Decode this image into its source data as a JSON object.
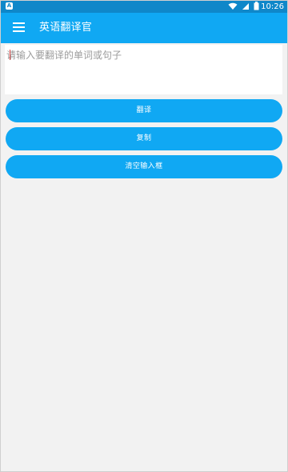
{
  "status_bar": {
    "left_badge": "A",
    "time": "10:26",
    "icons": [
      "wifi-icon",
      "cell-signal-icon",
      "battery-icon"
    ],
    "color": "#0f87c9"
  },
  "app_bar": {
    "title": "英语翻译官",
    "menu_icon": "menu-icon",
    "color": "#10a8f3"
  },
  "input": {
    "placeholder": "请输入要翻译的单词或句子",
    "value": ""
  },
  "buttons": {
    "translate": "翻译",
    "copy": "复制",
    "clear": "清空输入框"
  },
  "colors": {
    "accent": "#10a8f3",
    "background": "#f2f2f2",
    "cursor": "#e24a4a"
  }
}
